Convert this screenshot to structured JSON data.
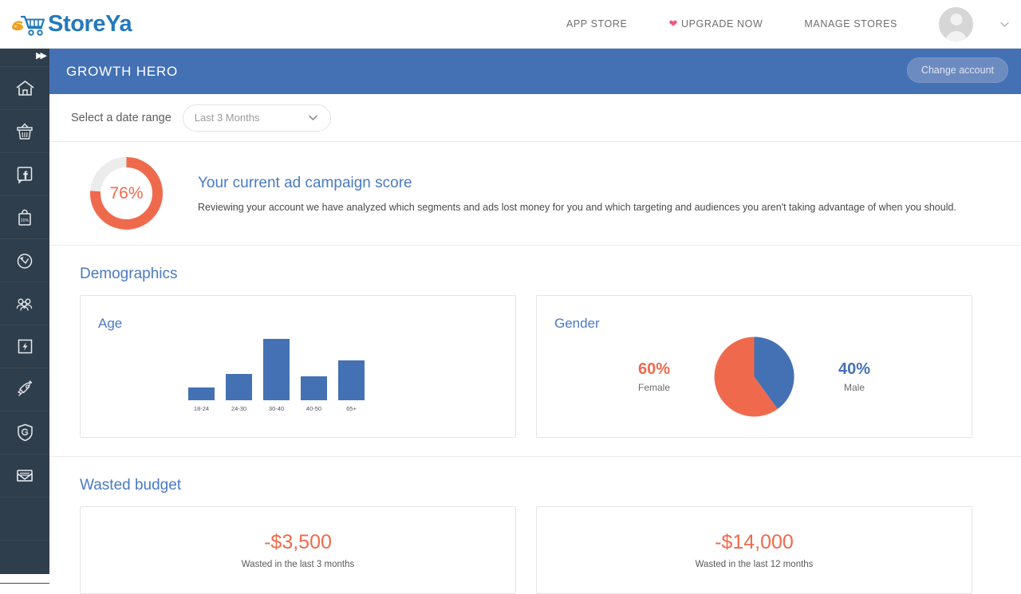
{
  "brand": {
    "name": "StoreYa",
    "logo_icon": "shopping-cart-icon"
  },
  "topnav": {
    "items": [
      {
        "label": "APP STORE",
        "icon": null
      },
      {
        "label": "UPGRADE NOW",
        "icon": "heart-icon"
      },
      {
        "label": "MANAGE STORES",
        "icon": null
      }
    ],
    "avatar_icon": "user-avatar-icon",
    "caret_icon": "chevron-down-icon"
  },
  "sidebar": {
    "expand_icon": "double-chevron-right-icon",
    "items": [
      {
        "icon": "home-icon"
      },
      {
        "icon": "basket-icon"
      },
      {
        "icon": "facebook-icon"
      },
      {
        "icon": "shopping-bag-discount-icon"
      },
      {
        "icon": "coupon-clock-icon"
      },
      {
        "icon": "group-people-icon"
      },
      {
        "icon": "lightning-bolt-icon"
      },
      {
        "icon": "rocket-icon"
      },
      {
        "icon": "shield-icon"
      },
      {
        "icon": "envelope-icon"
      }
    ]
  },
  "header": {
    "title": "GROWTH HERO",
    "change_account_label": "Change account"
  },
  "date_range": {
    "label": "Select a date range",
    "selected": "Last 3 Months",
    "caret_icon": "chevron-down-icon"
  },
  "score": {
    "value": "76%",
    "percent": 76,
    "title": "Your current ad campaign score",
    "description": "Reviewing your account we have analyzed which segments and ads lost money for you and which targeting and audiences you aren't taking advantage of when you should.",
    "ring_color": "#ef6a4c",
    "track_color": "#ececec"
  },
  "demographics": {
    "section_title": "Demographics",
    "age_card_title": "Age",
    "gender_card_title": "Gender",
    "gender": {
      "female_pct": "60%",
      "female_label": "Female",
      "male_pct": "40%",
      "male_label": "Male"
    }
  },
  "wasted_budget": {
    "section_title": "Wasted budget",
    "cards": [
      {
        "amount": "-$3,500",
        "caption": "Wasted in the last 3 months"
      },
      {
        "amount": "-$14,000",
        "caption": "Wasted in the last 12 months"
      }
    ]
  },
  "chart_data": [
    {
      "type": "bar",
      "title": "Age",
      "categories": [
        "18-24",
        "24-30",
        "30-40",
        "40-50",
        "65+"
      ],
      "values": [
        16,
        33,
        77,
        30,
        50
      ],
      "xlabel": "",
      "ylabel": "",
      "ylim": [
        0,
        92
      ],
      "grid": false,
      "legend": "none",
      "series_color": "#4471b4"
    },
    {
      "type": "pie",
      "title": "Gender",
      "categories": [
        "Male",
        "Female"
      ],
      "values": [
        40,
        60
      ],
      "labels": [
        "40%",
        "60%"
      ],
      "colors": [
        "#4471b4",
        "#ef6a4c"
      ],
      "legend": "sides",
      "start_angle_deg": 0
    }
  ]
}
